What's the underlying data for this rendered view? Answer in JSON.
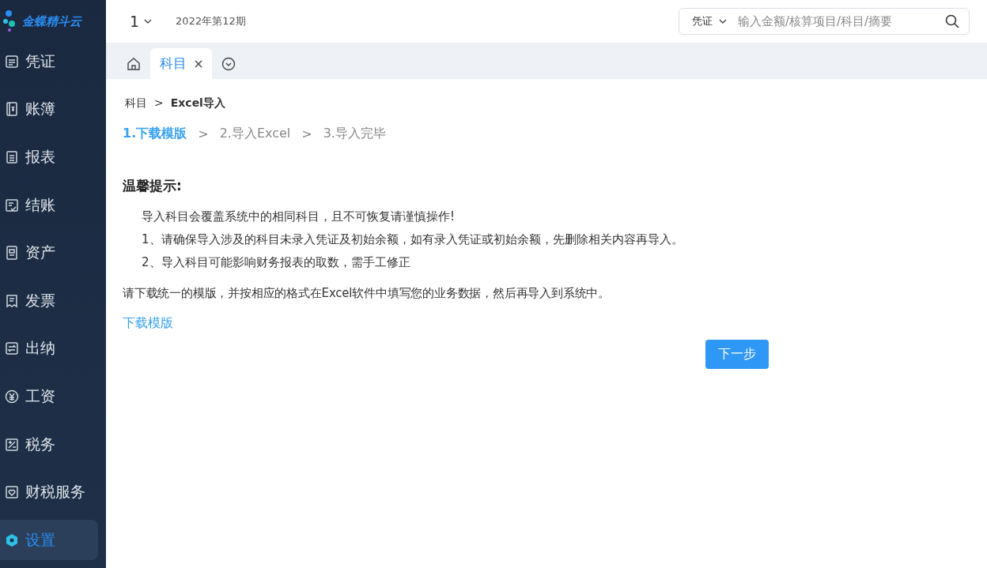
{
  "sidebar": {
    "logo_text": "金蝶精斗云",
    "items": [
      {
        "label": "凭证",
        "selected": false
      },
      {
        "label": "账簿",
        "selected": false
      },
      {
        "label": "报表",
        "selected": false
      },
      {
        "label": "结账",
        "selected": false
      },
      {
        "label": "资产",
        "selected": false
      },
      {
        "label": "发票",
        "selected": false
      },
      {
        "label": "出纳",
        "selected": false
      },
      {
        "label": "工资",
        "selected": false
      },
      {
        "label": "税务",
        "selected": false
      },
      {
        "label": "财税服务",
        "selected": false
      },
      {
        "label": "设置",
        "selected": true
      }
    ]
  },
  "topbar": {
    "account": "1",
    "period": "2022年第12期",
    "search_type": "凭证",
    "search": {
      "placeholder": "输入金额/核算项目/科目/摘要"
    }
  },
  "tabs": [
    {
      "label": "科目",
      "selected": true
    }
  ],
  "breadcrumb": [
    {
      "kind": "link",
      "text": "科目"
    },
    {
      "kind": "separator",
      "text": ">"
    },
    {
      "kind": "current",
      "text": "Excel导入"
    }
  ],
  "steps": [
    {
      "kind": "step",
      "label": "1.下载模版",
      "selected": true
    },
    {
      "kind": "separator",
      "label": ">"
    },
    {
      "kind": "step",
      "label": "2.导入Excel",
      "selected": false
    },
    {
      "kind": "separator",
      "label": ">"
    },
    {
      "kind": "step",
      "label": "3.导入完毕",
      "selected": false
    }
  ],
  "tips_title": "温馨提示:",
  "tips": [
    "导入科目会覆盖系统中的相同科目，且不可恢复请谨慎操作!",
    "1、请确保导入涉及的科目未录入凭证及初始余额，如有录入凭证或初始余额，先删除相关内容再导入。",
    "2、导入科目可能影响财务报表的取数，需手工修正"
  ],
  "instruction": "请下载统一的模版，并按相应的格式在Excel软件中填写您的业务数据，然后再导入到系统中。",
  "download_link": "下载模版",
  "next_button": "下一步"
}
